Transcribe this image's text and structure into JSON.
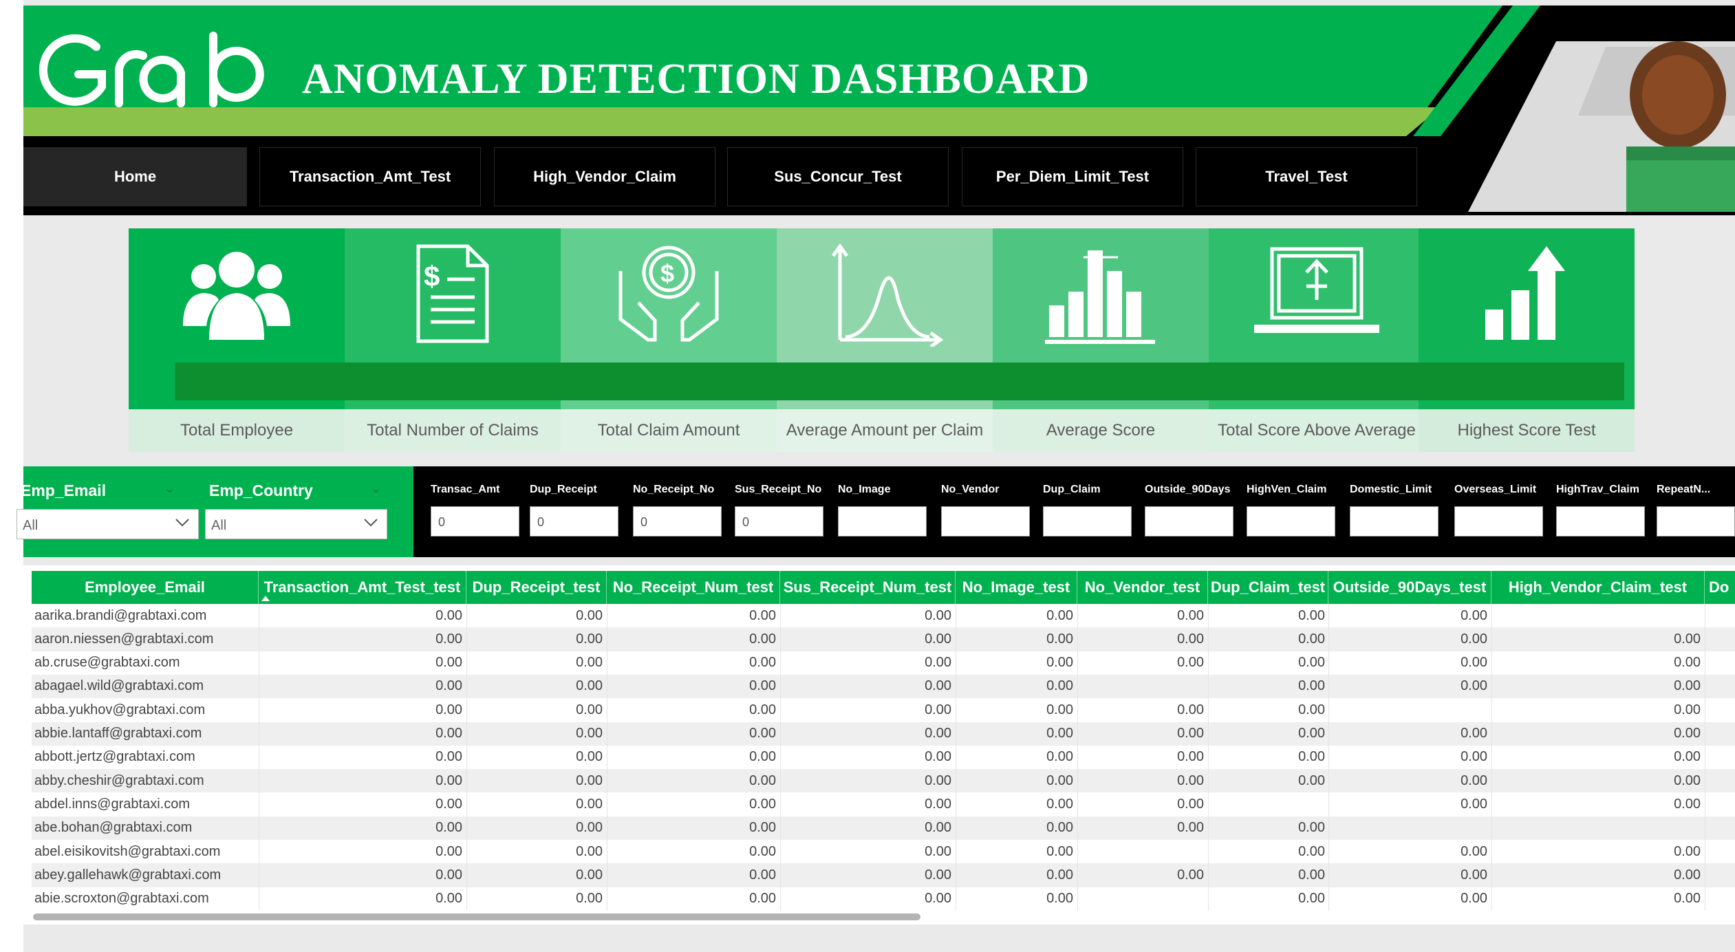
{
  "header": {
    "logo_text": "Grab",
    "title": "ANOMALY DETECTION DASHBOARD",
    "colors": {
      "brand_green": "#00b14f",
      "accent_lime": "#8bc34a"
    }
  },
  "nav": {
    "tabs": [
      "Home",
      "Transaction_Amt_Test",
      "High_Vendor_Claim",
      "Sus_Concur_Test",
      "Per_Diem_Limit_Test",
      "Travel_Test"
    ],
    "active": "Home"
  },
  "kpis": [
    {
      "label": "Total Employee",
      "icon": "group-people-icon"
    },
    {
      "label": "Total Number of Claims",
      "icon": "invoice-document-icon"
    },
    {
      "label": "Total Claim Amount",
      "icon": "money-hands-icon"
    },
    {
      "label": "Average Amount per Claim",
      "icon": "bell-curve-icon"
    },
    {
      "label": "Average Score",
      "icon": "bar-chart-average-icon"
    },
    {
      "label": "Total Score Above Average",
      "icon": "laptop-upload-icon"
    },
    {
      "label": "Highest Score Test",
      "icon": "rising-bars-icon"
    }
  ],
  "slicers": [
    {
      "label": "Emp_Email",
      "value": "All"
    },
    {
      "label": "Emp_Country",
      "value": "All"
    }
  ],
  "filters": [
    {
      "label": "Transac_Amt",
      "value": "0"
    },
    {
      "label": "Dup_Receipt",
      "value": "0"
    },
    {
      "label": "No_Receipt_No",
      "value": "0"
    },
    {
      "label": "Sus_Receipt_No",
      "value": "0"
    },
    {
      "label": "No_Image",
      "value": ""
    },
    {
      "label": "No_Vendor",
      "value": ""
    },
    {
      "label": "Dup_Claim",
      "value": ""
    },
    {
      "label": "Outside_90Days",
      "value": ""
    },
    {
      "label": "HighVen_Claim",
      "value": ""
    },
    {
      "label": "Domestic_Limit",
      "value": ""
    },
    {
      "label": "Overseas_Limit",
      "value": ""
    },
    {
      "label": "HighTrav_Claim",
      "value": ""
    },
    {
      "label": "RepeatN...",
      "value": ""
    }
  ],
  "table": {
    "columns": [
      "Employee_Email",
      "Transaction_Amt_Test_test",
      "Dup_Receipt_test",
      "No_Receipt_Num_test",
      "Sus_Receipt_Num_test",
      "No_Image_test",
      "No_Vendor_test",
      "Dup_Claim_test",
      "Outside_90Days_test",
      "High_Vendor_Claim_test",
      "Do"
    ],
    "rows": [
      [
        "aarika.brandi@grabtaxi.com",
        "0.00",
        "0.00",
        "0.00",
        "0.00",
        "0.00",
        "0.00",
        "0.00",
        "0.00",
        ""
      ],
      [
        "aaron.niessen@grabtaxi.com",
        "0.00",
        "0.00",
        "0.00",
        "0.00",
        "0.00",
        "0.00",
        "0.00",
        "0.00",
        "0.00"
      ],
      [
        "ab.cruse@grabtaxi.com",
        "0.00",
        "0.00",
        "0.00",
        "0.00",
        "0.00",
        "0.00",
        "0.00",
        "0.00",
        "0.00"
      ],
      [
        "abagael.wild@grabtaxi.com",
        "0.00",
        "0.00",
        "0.00",
        "0.00",
        "0.00",
        "",
        "0.00",
        "0.00",
        "0.00"
      ],
      [
        "abba.yukhov@grabtaxi.com",
        "0.00",
        "0.00",
        "0.00",
        "0.00",
        "0.00",
        "0.00",
        "0.00",
        "",
        "0.00"
      ],
      [
        "abbie.lantaff@grabtaxi.com",
        "0.00",
        "0.00",
        "0.00",
        "0.00",
        "0.00",
        "0.00",
        "0.00",
        "0.00",
        "0.00"
      ],
      [
        "abbott.jertz@grabtaxi.com",
        "0.00",
        "0.00",
        "0.00",
        "0.00",
        "0.00",
        "0.00",
        "0.00",
        "0.00",
        "0.00"
      ],
      [
        "abby.cheshir@grabtaxi.com",
        "0.00",
        "0.00",
        "0.00",
        "0.00",
        "0.00",
        "0.00",
        "0.00",
        "0.00",
        "0.00"
      ],
      [
        "abdel.inns@grabtaxi.com",
        "0.00",
        "0.00",
        "0.00",
        "0.00",
        "0.00",
        "0.00",
        "",
        "0.00",
        "0.00"
      ],
      [
        "abe.bohan@grabtaxi.com",
        "0.00",
        "0.00",
        "0.00",
        "0.00",
        "0.00",
        "0.00",
        "0.00",
        "",
        ""
      ],
      [
        "abel.eisikovitsh@grabtaxi.com",
        "0.00",
        "0.00",
        "0.00",
        "0.00",
        "0.00",
        "",
        "0.00",
        "0.00",
        "0.00"
      ],
      [
        "abey.gallehawk@grabtaxi.com",
        "0.00",
        "0.00",
        "0.00",
        "0.00",
        "0.00",
        "0.00",
        "0.00",
        "0.00",
        "0.00"
      ],
      [
        "abie.scroxton@grabtaxi.com",
        "0.00",
        "0.00",
        "0.00",
        "0.00",
        "0.00",
        "",
        "0.00",
        "0.00",
        "0.00"
      ]
    ]
  }
}
